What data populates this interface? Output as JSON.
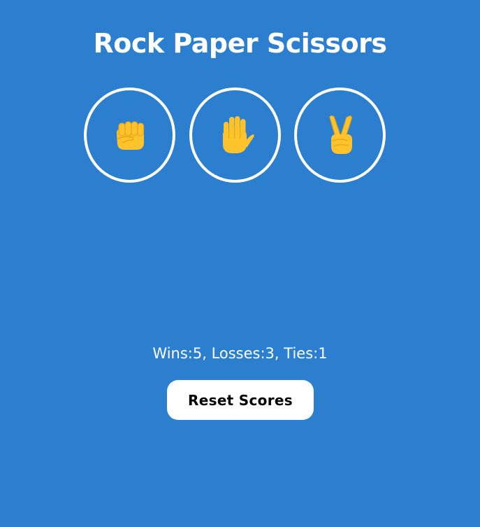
{
  "game": {
    "title": "Rock Paper Scissors"
  },
  "choices": [
    {
      "name": "rock",
      "icon": "raised-fist-icon"
    },
    {
      "name": "paper",
      "icon": "raised-hand-icon"
    },
    {
      "name": "scissors",
      "icon": "victory-hand-icon"
    }
  ],
  "scoreboard": {
    "text": "Wins:5, Losses:3, Ties:1"
  },
  "actions": {
    "reset_label": "Reset Scores"
  },
  "colors": {
    "background": "#2b7fce",
    "circle_border": "#ffffff",
    "hand_fill": "#fcc32c",
    "hand_shade": "#e9a51a",
    "button_bg": "#ffffff"
  }
}
